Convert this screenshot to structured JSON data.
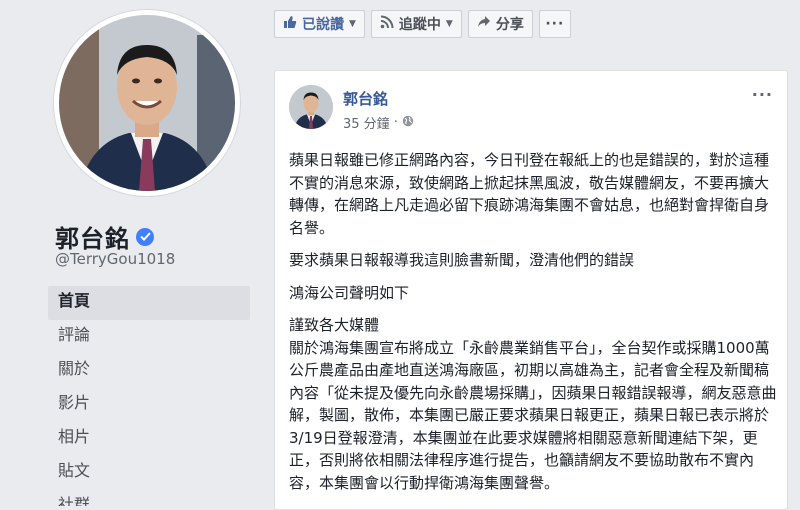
{
  "profile": {
    "name": "郭台銘",
    "handle": "@TerryGou1018",
    "nav": [
      "首頁",
      "評論",
      "關於",
      "影片",
      "相片",
      "貼文",
      "社群"
    ]
  },
  "actions": {
    "liked_label": "已說讚",
    "following_label": "追蹤中",
    "share_label": "分享",
    "more_label": "···"
  },
  "post": {
    "author": "郭台銘",
    "time": "35 分鐘",
    "time_sep": "·",
    "more_label": "···",
    "paragraphs": [
      "蘋果日報雖已修正網路內容，今日刊登在報紙上的也是錯誤的，對於這種不實的消息來源，致使網路上掀起抹黑風波，敬告媒體網友，不要再擴大轉傳，在網路上凡走過必留下痕跡鴻海集團不會姑息，也絕對會捍衛自身名譽。",
      "要求蘋果日報報導我這則臉書新聞，澄清他們的錯誤",
      "鴻海公司聲明如下",
      "謹致各大媒體",
      "關於鴻海集團宣布將成立「永齡農業銷售平台」，全台契作或採購1000萬公斤農產品由產地直送鴻海廠區，初期以高雄為主，記者會全程及新聞稿內容「從未提及優先向永齡農場採購」，因蘋果日報錯誤報導，網友惡意曲解，製圖，散佈，本集團已嚴正要求蘋果日報更正，蘋果日報已表示將於3/19日登報澄清，本集團並在此要求媒體將相關惡意新聞連結下架，更正，否則將依相關法律程序進行提告，也籲請網友不要協助散布不實內容，本集團會以行動捍衛鴻海集團聲譽。"
    ]
  },
  "colors": {
    "link": "#385898",
    "background": "#e9ebee",
    "verified": "#4080ff"
  }
}
